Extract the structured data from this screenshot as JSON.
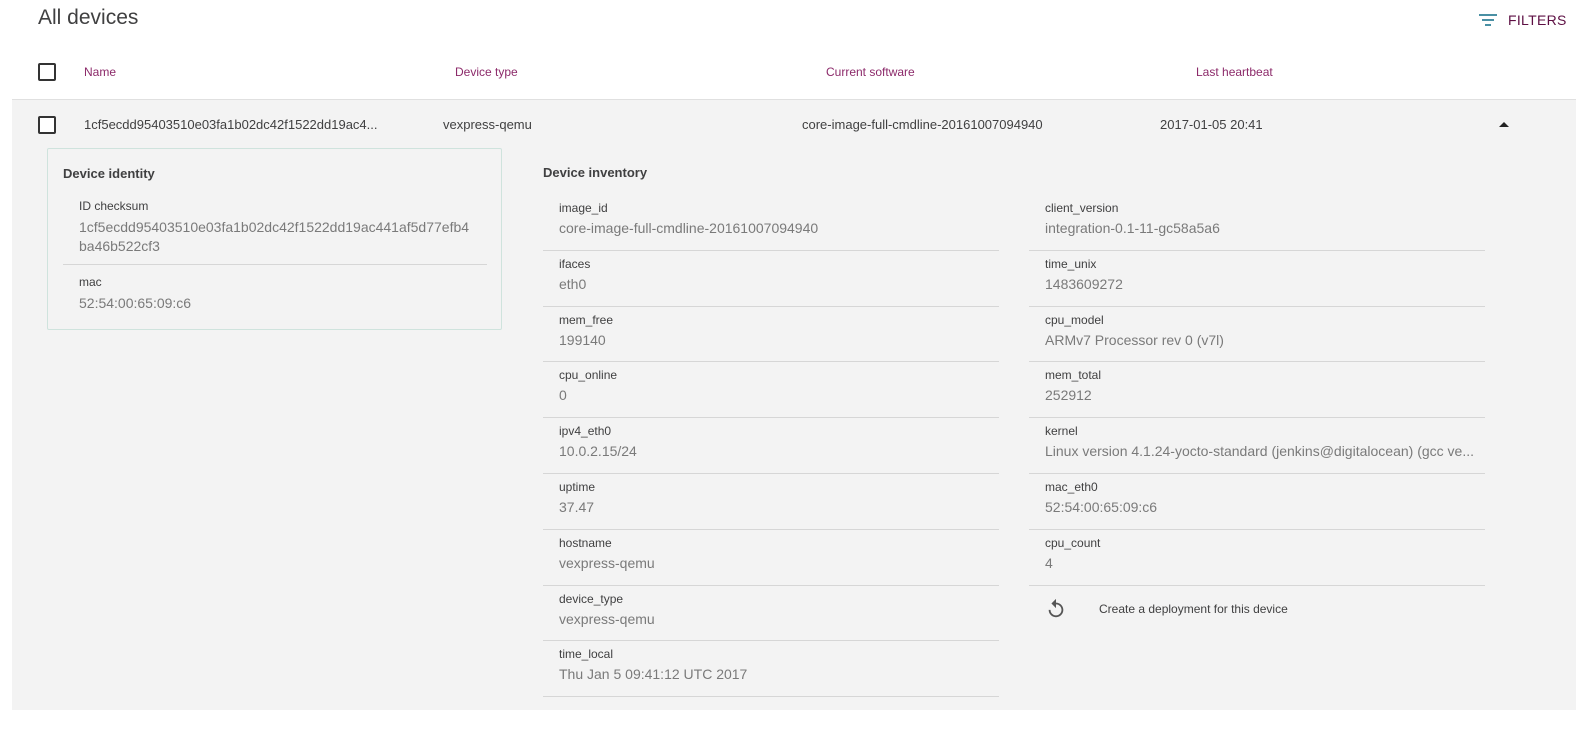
{
  "page": {
    "title": "All devices",
    "filters_label": "FILTERS"
  },
  "table": {
    "columns": [
      "Name",
      "Device type",
      "Current software",
      "Last heartbeat"
    ],
    "row": {
      "name": "1cf5ecdd95403510e03fa1b02dc42f1522dd19ac4...",
      "device_type": "vexpress-qemu",
      "current_software": "core-image-full-cmdline-20161007094940",
      "last_heartbeat": "2017-01-05 20:41"
    }
  },
  "identity": {
    "title": "Device identity",
    "items": [
      {
        "label": "ID checksum",
        "value": "1cf5ecdd95403510e03fa1b02dc42f1522dd19ac441af5d77efb4ba46b522cf3"
      },
      {
        "label": "mac",
        "value": "52:54:00:65:09:c6"
      }
    ]
  },
  "inventory": {
    "title": "Device inventory",
    "left": [
      {
        "label": "image_id",
        "value": "core-image-full-cmdline-20161007094940"
      },
      {
        "label": "ifaces",
        "value": "eth0"
      },
      {
        "label": "mem_free",
        "value": "199140"
      },
      {
        "label": "cpu_online",
        "value": "0"
      },
      {
        "label": "ipv4_eth0",
        "value": "10.0.2.15/24"
      },
      {
        "label": "uptime",
        "value": "37.47"
      },
      {
        "label": "hostname",
        "value": "vexpress-qemu"
      },
      {
        "label": "device_type",
        "value": "vexpress-qemu"
      },
      {
        "label": "time_local",
        "value": "Thu Jan 5 09:41:12 UTC 2017"
      }
    ],
    "right": [
      {
        "label": "client_version",
        "value": "integration-0.1-11-gc58a5a6"
      },
      {
        "label": "time_unix",
        "value": "1483609272"
      },
      {
        "label": "cpu_model",
        "value": "ARMv7 Processor rev 0 (v7l)"
      },
      {
        "label": "mem_total",
        "value": "252912"
      },
      {
        "label": "kernel",
        "value": "Linux version 4.1.24-yocto-standard (jenkins@digitalocean) (gcc ve..."
      },
      {
        "label": "mac_eth0",
        "value": "52:54:00:65:09:c6"
      },
      {
        "label": "cpu_count",
        "value": "4"
      }
    ]
  },
  "deploy": {
    "label": "Create a deployment for this device",
    "icon": "replay-icon"
  },
  "colors": {
    "accent": "#8c2a6a",
    "filters": "#5d0f43",
    "filter_icon": "#4a90a4",
    "panel_bg": "#f3f3f3"
  }
}
